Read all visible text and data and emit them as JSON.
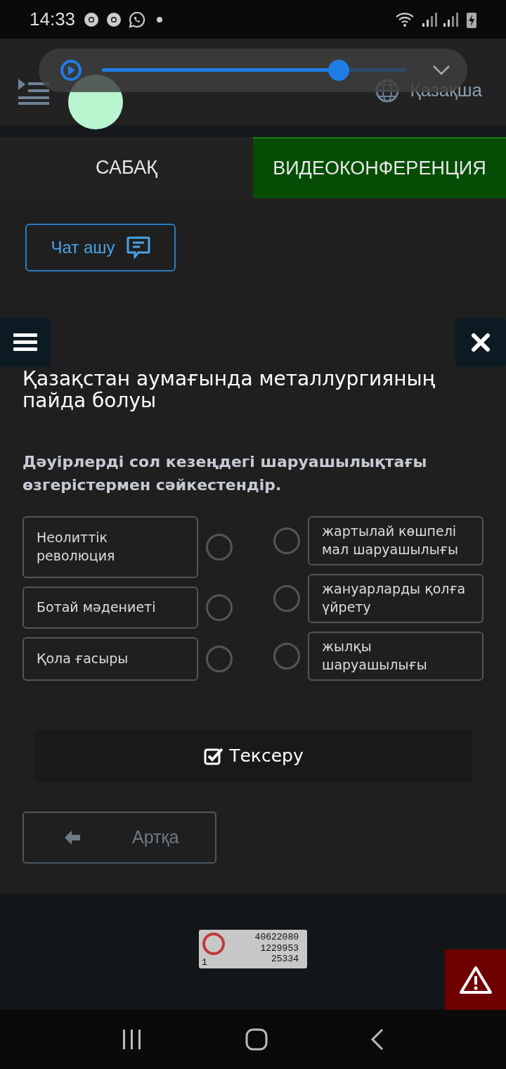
{
  "status_bar": {
    "time": "14:33"
  },
  "header": {
    "language": "Қазақша"
  },
  "media_player": {
    "level": 0.8
  },
  "tabs": [
    {
      "label": "САБАҚ",
      "selected": false
    },
    {
      "label": "ВИДЕОКОНФЕРЕНЦИЯ",
      "selected": true
    }
  ],
  "chat_button": {
    "label": "Чат ашу"
  },
  "title": "Қазақстан аумағында металлургияның пайда болуы",
  "instruction": "Дәуірлерді сол кезеңдегі шаруашылықтағы өзгерістермен сәйкестендір.",
  "left_items": [
    {
      "text": "Неолиттік революция",
      "selected": false
    },
    {
      "text": "Ботай мәдениеті",
      "selected": false
    },
    {
      "text": "Қола ғасыры",
      "selected": false
    }
  ],
  "right_items": [
    {
      "text": "жартылай көшпелі мал шаруашылығы",
      "selected": false
    },
    {
      "text": "жануарларды қолға үйрету",
      "selected": false
    },
    {
      "text": "жылқы шаруашылығы",
      "selected": false
    }
  ],
  "check_button": {
    "label": "Тексеру"
  },
  "back_button": {
    "label": "Артқа"
  },
  "counter": {
    "lines": [
      "40622080",
      "1229953",
      "25334"
    ],
    "corner": "1"
  }
}
